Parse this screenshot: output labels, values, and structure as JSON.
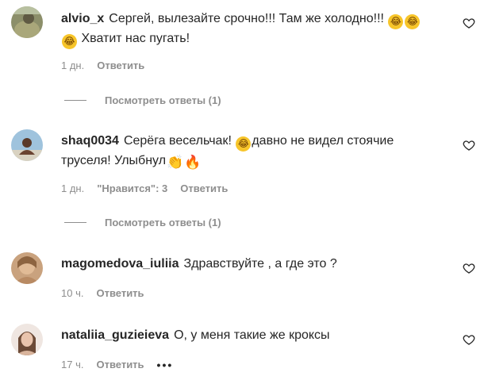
{
  "comments": [
    {
      "username": "alvio_x",
      "text_part1": "Сергей, вылезайте срочно!!! Там же холодно!!!",
      "text_part2": "Хватит нас пугать!",
      "time": "1 дн.",
      "reply_label": "Ответить",
      "view_replies": "Посмотреть ответы (1)"
    },
    {
      "username": "shaq0034",
      "text_part1": "Серёга весельчак!",
      "text_part2": "давно не видел стоячие труселя! Улыбнул",
      "time": "1 дн.",
      "likes": "\"Нравится\": 3",
      "reply_label": "Ответить",
      "view_replies": "Посмотреть ответы (1)"
    },
    {
      "username": "magomedova_iuliia",
      "text": "Здравствуйте , а где это ?",
      "time": "10 ч.",
      "reply_label": "Ответить"
    },
    {
      "username": "nataliia_guzieieva",
      "text": "О, у меня такие же кроксы",
      "time": "17 ч.",
      "reply_label": "Ответить",
      "more": "•••"
    }
  ],
  "icons": {
    "heart": "heart-outline-icon",
    "laugh": "tears-of-joy-emoji",
    "clap": "clapping-hands-emoji",
    "fire": "fire-emoji"
  },
  "colors": {
    "text": "#262626",
    "secondary": "#8e8e8e"
  }
}
